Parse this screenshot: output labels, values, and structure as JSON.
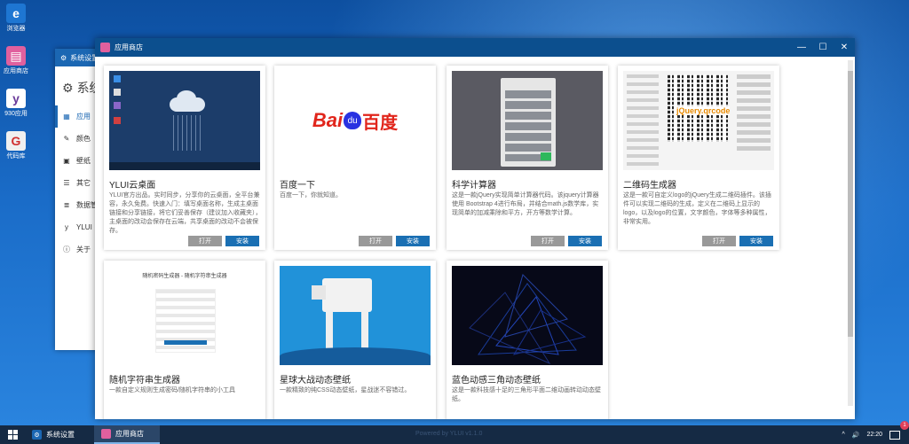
{
  "desktop": {
    "icons": [
      {
        "label": "浏览器",
        "icon": "ie-icon",
        "color": "#1e76d2",
        "glyph": "e"
      },
      {
        "label": "应用商店",
        "icon": "store-bag-icon",
        "color": "#e0609e",
        "glyph": "▤"
      },
      {
        "label": "930应用",
        "icon": "yl-icon",
        "color": "#ffffff",
        "glyph": "y"
      },
      {
        "label": "代码库",
        "icon": "code-lib-icon",
        "color": "#f0f0f0",
        "glyph": "G"
      }
    ]
  },
  "settings_window": {
    "title": "系统设置",
    "big_title": "系统",
    "nav": [
      {
        "label": "应用",
        "icon": "grid-icon",
        "glyph": "▦",
        "active": true
      },
      {
        "label": "颜色",
        "icon": "brush-icon",
        "glyph": "✎",
        "active": false
      },
      {
        "label": "壁纸",
        "icon": "image-icon",
        "glyph": "▣",
        "active": false
      },
      {
        "label": "其它",
        "icon": "list-icon",
        "glyph": "☰",
        "active": false
      },
      {
        "label": "数据管",
        "icon": "database-icon",
        "glyph": "≣",
        "active": false
      },
      {
        "label": "YLUI",
        "icon": "ylui-icon",
        "glyph": "y",
        "active": false
      },
      {
        "label": "关于",
        "icon": "info-icon",
        "glyph": "ⓘ",
        "active": false
      }
    ]
  },
  "store_window": {
    "title": "应用商店",
    "controls": {
      "minimize": "—",
      "maximize": "☐",
      "close": "✕"
    },
    "open_label": "打开",
    "install_label": "安装",
    "apps": [
      {
        "title": "YLUI云桌面",
        "desc": "YLUI官方出品。实时同步，分享你的云桌面，全平台兼容，永久免费。快速入门：填写桌面名称，生成主桌面链接和分享链接，将它们妥善保存（建议加入收藏夹），主桌面的改动会保存在云端，共享桌面的改动不会被保存。",
        "buttons": true
      },
      {
        "title": "百度一下",
        "desc": "百度一下，你就知道。",
        "buttons": true
      },
      {
        "title": "科学计算器",
        "desc": "这是一款jQuery实现简单计算器代码。该jquery计算器使用 Bootstrap 4进行布局，并结合math.js数学库，实现简单的加减乘除和平方，开方等数学计算。",
        "buttons": true
      },
      {
        "title": "二维码生成器",
        "desc": "这是一款可自定义logo的jQuery生成二维码插件。该插件可以实现二维码的生成，定义在二维码上显示的logo，以及logo的位置，文字颜色，字体等多种属性，非常实用。",
        "buttons": true
      },
      {
        "title": "随机字符串生成器",
        "desc": "一款自定义规则生成密码/随机字符串的小工具",
        "buttons": false
      },
      {
        "title": "星球大战动态壁纸",
        "desc": "一款精致的纯CSS动态壁纸，星战迷不容错过。",
        "buttons": false
      },
      {
        "title": "蓝色动感三角动态壁纸",
        "desc": "这是一款科技感十足的三角形平面二维动画转动动态壁纸。",
        "buttons": false
      }
    ],
    "thumb_texts": {
      "baidu_left": "Bai",
      "baidu_mid": "du",
      "baidu_right": "百度",
      "qr_caption": "jQuery.qrcode",
      "rand_heading": "随机密码生成器 - 随机字符串生成器"
    }
  },
  "taskbar": {
    "items": [
      {
        "label": "系统设置",
        "icon": "settings-gear-icon",
        "color": "#1b67b3",
        "active": false
      },
      {
        "label": "应用商店",
        "icon": "store-bag-icon",
        "color": "#e0609e",
        "active": true
      }
    ],
    "powered": "Powered by YLUI v1.1.0",
    "time": "22:20",
    "notif_count": "1",
    "tray_arrow": "^",
    "speaker": "🔊"
  }
}
